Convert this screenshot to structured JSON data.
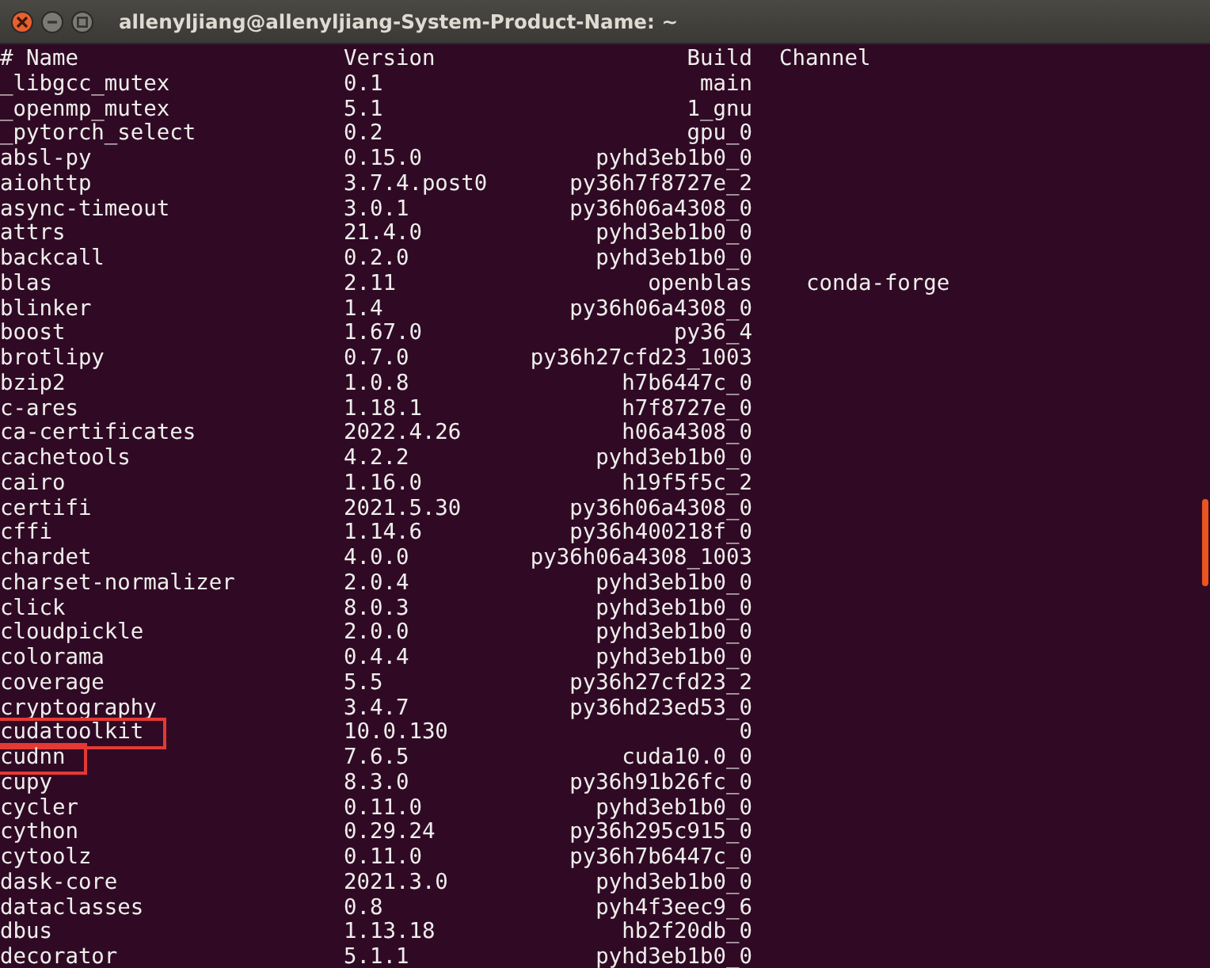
{
  "window": {
    "title": "allenyljiang@allenyljiang-System-Product-Name: ~"
  },
  "table": {
    "columns": [
      "# Name",
      "Version",
      "Build",
      "Channel"
    ],
    "rows": [
      {
        "name": "_libgcc_mutex",
        "version": "0.1",
        "build": "main",
        "highlighted": false
      },
      {
        "name": "_openmp_mutex",
        "version": "5.1",
        "build": "1_gnu",
        "highlighted": false
      },
      {
        "name": "_pytorch_select",
        "version": "0.2",
        "build": "gpu_0",
        "highlighted": false
      },
      {
        "name": "absl-py",
        "version": "0.15.0",
        "build": "pyhd3eb1b0_0",
        "highlighted": false
      },
      {
        "name": "aiohttp",
        "version": "3.7.4.post0",
        "build": "py36h7f8727e_2",
        "highlighted": false
      },
      {
        "name": "async-timeout",
        "version": "3.0.1",
        "build": "py36h06a4308_0",
        "highlighted": false
      },
      {
        "name": "attrs",
        "version": "21.4.0",
        "build": "pyhd3eb1b0_0",
        "highlighted": false
      },
      {
        "name": "backcall",
        "version": "0.2.0",
        "build": "pyhd3eb1b0_0",
        "highlighted": false
      },
      {
        "name": "blas",
        "version": "2.11",
        "build": "openblas",
        "channel": "conda-forge",
        "highlighted": false
      },
      {
        "name": "blinker",
        "version": "1.4",
        "build": "py36h06a4308_0",
        "highlighted": false
      },
      {
        "name": "boost",
        "version": "1.67.0",
        "build": "py36_4",
        "highlighted": false
      },
      {
        "name": "brotlipy",
        "version": "0.7.0",
        "build": "py36h27cfd23_1003",
        "highlighted": false
      },
      {
        "name": "bzip2",
        "version": "1.0.8",
        "build": "h7b6447c_0",
        "highlighted": false
      },
      {
        "name": "c-ares",
        "version": "1.18.1",
        "build": "h7f8727e_0",
        "highlighted": false
      },
      {
        "name": "ca-certificates",
        "version": "2022.4.26",
        "build": "h06a4308_0",
        "highlighted": false
      },
      {
        "name": "cachetools",
        "version": "4.2.2",
        "build": "pyhd3eb1b0_0",
        "highlighted": false
      },
      {
        "name": "cairo",
        "version": "1.16.0",
        "build": "h19f5f5c_2",
        "highlighted": false
      },
      {
        "name": "certifi",
        "version": "2021.5.30",
        "build": "py36h06a4308_0",
        "highlighted": false
      },
      {
        "name": "cffi",
        "version": "1.14.6",
        "build": "py36h400218f_0",
        "highlighted": false
      },
      {
        "name": "chardet",
        "version": "4.0.0",
        "build": "py36h06a4308_1003",
        "highlighted": false
      },
      {
        "name": "charset-normalizer",
        "version": "2.0.4",
        "build": "pyhd3eb1b0_0",
        "highlighted": false
      },
      {
        "name": "click",
        "version": "8.0.3",
        "build": "pyhd3eb1b0_0",
        "highlighted": false
      },
      {
        "name": "cloudpickle",
        "version": "2.0.0",
        "build": "pyhd3eb1b0_0",
        "highlighted": false
      },
      {
        "name": "colorama",
        "version": "0.4.4",
        "build": "pyhd3eb1b0_0",
        "highlighted": false
      },
      {
        "name": "coverage",
        "version": "5.5",
        "build": "py36h27cfd23_2",
        "highlighted": false
      },
      {
        "name": "cryptography",
        "version": "3.4.7",
        "build": "py36hd23ed53_0",
        "highlighted": false
      },
      {
        "name": "cudatoolkit",
        "version": "10.0.130",
        "build": "0",
        "highlighted": true
      },
      {
        "name": "cudnn",
        "version": "7.6.5",
        "build": "cuda10.0_0",
        "highlighted": true
      },
      {
        "name": "cupy",
        "version": "8.3.0",
        "build": "py36h91b26fc_0",
        "highlighted": false
      },
      {
        "name": "cycler",
        "version": "0.11.0",
        "build": "pyhd3eb1b0_0",
        "highlighted": false
      },
      {
        "name": "cython",
        "version": "0.29.24",
        "build": "py36h295c915_0",
        "highlighted": false
      },
      {
        "name": "cytoolz",
        "version": "0.11.0",
        "build": "py36h7b6447c_0",
        "highlighted": false
      },
      {
        "name": "dask-core",
        "version": "2021.3.0",
        "build": "pyhd3eb1b0_0",
        "highlighted": false
      },
      {
        "name": "dataclasses",
        "version": "0.8",
        "build": "pyh4f3eec9_6",
        "highlighted": false
      },
      {
        "name": "dbus",
        "version": "1.13.18",
        "build": "hb2f20db_0",
        "highlighted": false
      },
      {
        "name": "decorator",
        "version": "5.1.1",
        "build": "pyhd3eb1b0_0",
        "highlighted": false
      }
    ]
  }
}
